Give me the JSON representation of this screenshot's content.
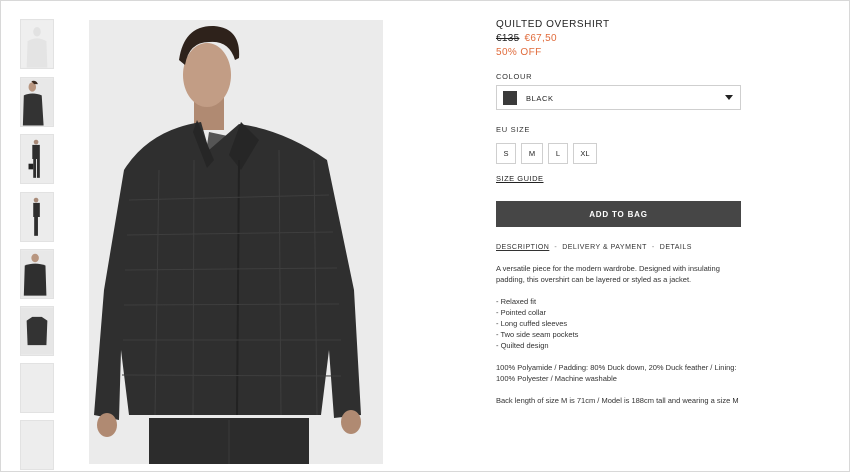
{
  "product": {
    "title": "QUILTED OVERSHIRT",
    "old_price": "€135",
    "new_price": "€67,50",
    "discount": "50% OFF"
  },
  "colour": {
    "label": "COLOUR",
    "selected": "BLACK",
    "swatch_color": "#3a3a3a"
  },
  "size": {
    "label": "EU SIZE",
    "options": [
      "S",
      "M",
      "L",
      "XL"
    ],
    "guide_label": "SIZE GUIDE"
  },
  "actions": {
    "add_to_bag": "ADD TO BAG"
  },
  "tabs": [
    {
      "label": "DESCRIPTION",
      "active": true
    },
    {
      "label": "DELIVERY & PAYMENT",
      "active": false
    },
    {
      "label": "DETAILS",
      "active": false
    }
  ],
  "tab_separator": "-",
  "description": {
    "intro": "A versatile piece for the modern wardrobe. Designed with insulating padding, this overshirt can be layered or styled as a jacket.",
    "features": [
      "Relaxed fit",
      "Pointed collar",
      "Long cuffed sleeves",
      "Two side seam pockets",
      "Quilted design"
    ],
    "composition": "100% Polyamide / Padding: 80% Duck down, 20% Duck feather / Lining: 100% Polyester / Machine washable",
    "fit_note": "Back length of size M is 71cm / Model is 188cm tall and wearing a size M"
  },
  "colors": {
    "accent": "#e06b3b",
    "button_bg": "#464646",
    "image_bg": "#ebebeb"
  },
  "icons": {
    "dropdown": "chevron-down-icon"
  }
}
